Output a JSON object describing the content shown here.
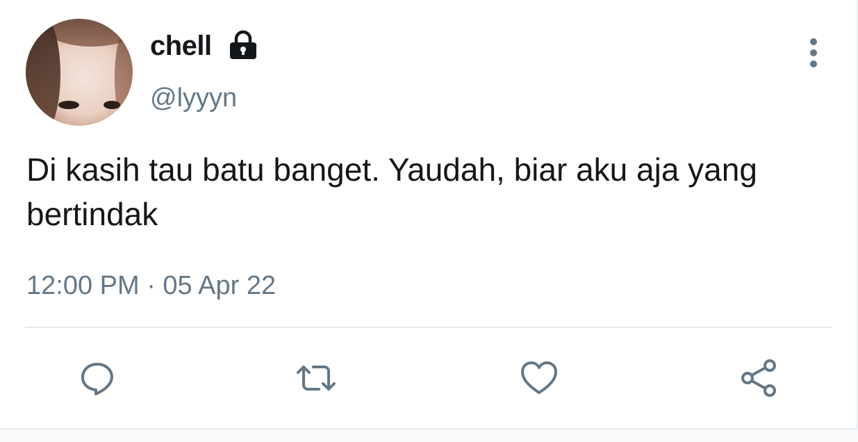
{
  "tweet": {
    "author": {
      "display_name": "chell",
      "handle": "@lyyyn",
      "protected": true
    },
    "text": "Di kasih tau batu banget. Yaudah, biar aku aja yang bertindak",
    "timestamp": "12:00 PM · 05 Apr 22"
  },
  "actions": [
    {
      "name": "reply",
      "icon": "speech-bubble-icon"
    },
    {
      "name": "retweet",
      "icon": "retweet-arrows-icon"
    },
    {
      "name": "like",
      "icon": "heart-icon"
    },
    {
      "name": "share",
      "icon": "share-nodes-icon"
    }
  ],
  "colors": {
    "primary_text": "#14171a",
    "secondary_text": "#657786",
    "divider": "#e6ecf0"
  }
}
